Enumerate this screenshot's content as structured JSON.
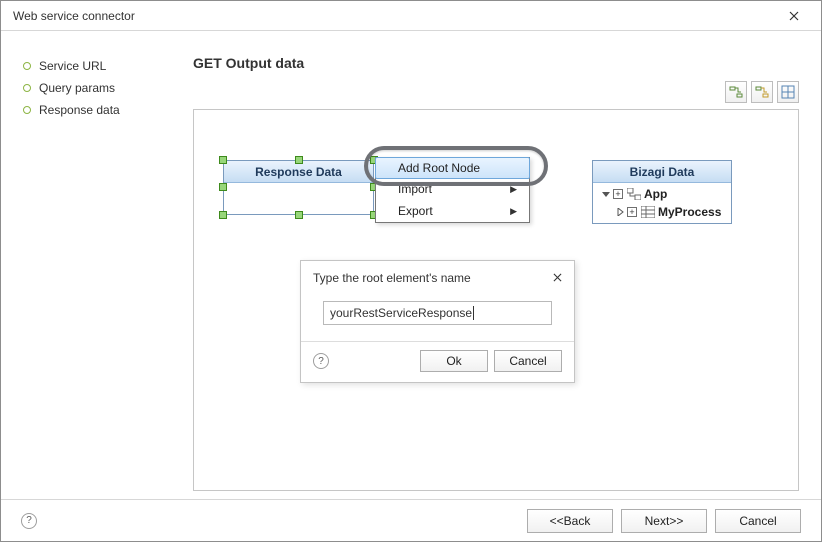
{
  "window": {
    "title": "Web service connector"
  },
  "sidebar": {
    "steps": [
      {
        "label": "Service URL"
      },
      {
        "label": "Query params"
      },
      {
        "label": "Response data"
      }
    ]
  },
  "page": {
    "title": "GET Output data"
  },
  "toolbar": {
    "btn1_name": "expand-all-icon",
    "btn2_name": "collapse-all-icon",
    "btn3_name": "auto-layout-icon"
  },
  "responseBox": {
    "header": "Response Data"
  },
  "contextMenu": {
    "items": [
      {
        "label": "Add Root Node",
        "submenu": false,
        "highlight": true
      },
      {
        "label": "Import",
        "submenu": true,
        "highlight": false
      },
      {
        "label": "Export",
        "submenu": true,
        "highlight": false
      }
    ]
  },
  "bizagiBox": {
    "header": "Bizagi Data",
    "tree": {
      "root": {
        "label": "App"
      },
      "child": {
        "label": "MyProcess"
      }
    }
  },
  "modal": {
    "title": "Type the root element's name",
    "inputValue": "yourRestServiceResponse",
    "ok": "Ok",
    "cancel": "Cancel"
  },
  "footer": {
    "back": "<<Back",
    "next": "Next>>",
    "cancel": "Cancel"
  }
}
